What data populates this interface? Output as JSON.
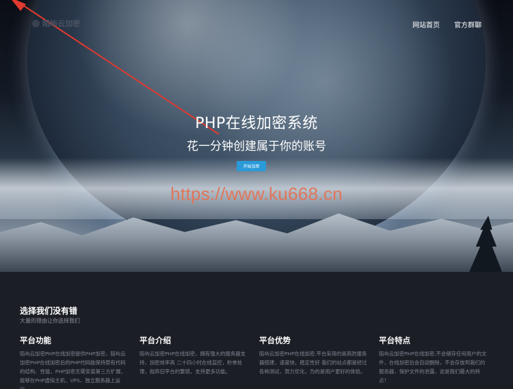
{
  "header": {
    "logo_text": "陌屿云加密",
    "nav": [
      "网站首页",
      "官方群聊"
    ]
  },
  "hero": {
    "title": "PHP在线加密系统",
    "subtitle": "花一分钟创建属于你的账号",
    "cta_label": "开始加密",
    "watermark": "https://www.ku668.cn"
  },
  "section": {
    "title": "选择我们没有错",
    "subtitle": "大量的理由让你选择我们",
    "features": [
      {
        "title": "平台功能",
        "text": "陌屿云加密PHP在线加密提供PHP加密，陌屿云加密PHP在线加密后的PHP代码能保持原有代码的结构、性能，PHP加密无需安装第三方扩展，能够在PHP虚拟主机、VPS、独立服务器上运行。"
      },
      {
        "title": "平台介绍",
        "text": "陌屿云加密PHP在线加密，拥有强大的服务器支持，加密效率高 二十四小时在线监控，秒单处理，抛弃旧平台的繁琐，支持更多功能。"
      },
      {
        "title": "平台优势",
        "text": "陌屿云加密PHP在线加密,平台采用的是高防服务器搭建，速度快，稳定性好 我们的站点都是经过各种测试，努力优化，为的是用户更好的体验。"
      },
      {
        "title": "平台特点",
        "text": "陌屿云加密PHP在线加密,不会储存任何用户的文件，在线加密后会自动删除，不会存放到我们的服务器，保护文件的泄露，这是我们最大的特点！"
      }
    ]
  },
  "colors": {
    "cta": "#2a9ad9",
    "watermark": "#e0765a",
    "arrow": "#e03a2f",
    "section_bg": "#1c1e26"
  }
}
